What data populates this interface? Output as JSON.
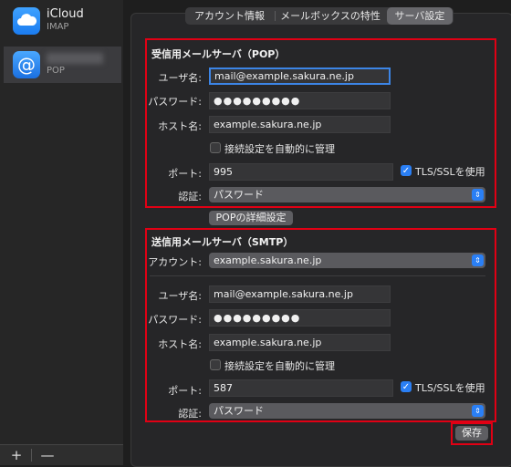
{
  "sidebar": {
    "accounts": [
      {
        "name": "iCloud",
        "type": "IMAP"
      },
      {
        "name": "",
        "type": "POP"
      }
    ],
    "add_label": "+",
    "remove_label": "—"
  },
  "tabs": [
    {
      "label": "アカウント情報"
    },
    {
      "label": "メールボックスの特性"
    },
    {
      "label": "サーバ設定"
    }
  ],
  "incoming": {
    "title": "受信用メールサーバ（POP）",
    "username_label": "ユーザ名:",
    "username": "mail@example.sakura.ne.jp",
    "password_label": "パスワード:",
    "password": "●●●●●●●●●",
    "host_label": "ホスト名:",
    "host": "example.sakura.ne.jp",
    "auto_manage_label": "接続設定を自動的に管理",
    "port_label": "ポート:",
    "port": "995",
    "tls_label": "TLS/SSLを使用",
    "auth_label": "認証:",
    "auth": "パスワード",
    "advanced_button": "POPの詳細設定"
  },
  "outgoing": {
    "title": "送信用メールサーバ（SMTP）",
    "account_label": "アカウント:",
    "account": "example.sakura.ne.jp",
    "username_label": "ユーザ名:",
    "username": "mail@example.sakura.ne.jp",
    "password_label": "パスワード:",
    "password": "●●●●●●●●●",
    "host_label": "ホスト名:",
    "host": "example.sakura.ne.jp",
    "auto_manage_label": "接続設定を自動的に管理",
    "port_label": "ポート:",
    "port": "587",
    "tls_label": "TLS/SSLを使用",
    "auth_label": "認証:",
    "auth": "パスワード"
  },
  "save_button": "保存",
  "colors": {
    "highlight_box": "#e10014",
    "accent": "#2a7ff5"
  }
}
